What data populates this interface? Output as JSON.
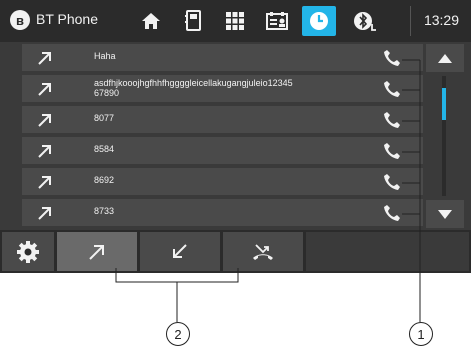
{
  "header": {
    "app_title": "BT Phone",
    "clock": "13:29",
    "icons": [
      "bluetooth-icon",
      "home-icon",
      "phonebook-icon",
      "keypad-icon",
      "contacts-card-icon",
      "call-history-icon",
      "bluetooth-settings-icon"
    ],
    "active_icon": "call-history-icon"
  },
  "calls": [
    {
      "name": "Haha",
      "direction": "outgoing"
    },
    {
      "name": "asdfhjkooojhgfhhfhggggleicellakugangjuleio12345\n67890",
      "direction": "outgoing"
    },
    {
      "name": "8077",
      "direction": "outgoing"
    },
    {
      "name": "8584",
      "direction": "outgoing"
    },
    {
      "name": "8692",
      "direction": "outgoing"
    },
    {
      "name": "8733",
      "direction": "outgoing"
    }
  ],
  "tabs": [
    {
      "icon": "settings-gear-icon",
      "active": false
    },
    {
      "icon": "outgoing-calls-icon",
      "active": true
    },
    {
      "icon": "incoming-calls-icon",
      "active": false
    },
    {
      "icon": "missed-calls-icon",
      "active": false
    }
  ],
  "callouts": {
    "one": "1",
    "two": "2"
  },
  "colors": {
    "accent": "#23b5e8",
    "background": "#3a3a3a",
    "bar": "#2b2b2b",
    "row": "#4a4a4a",
    "active_tab": "#6a6a6a"
  }
}
